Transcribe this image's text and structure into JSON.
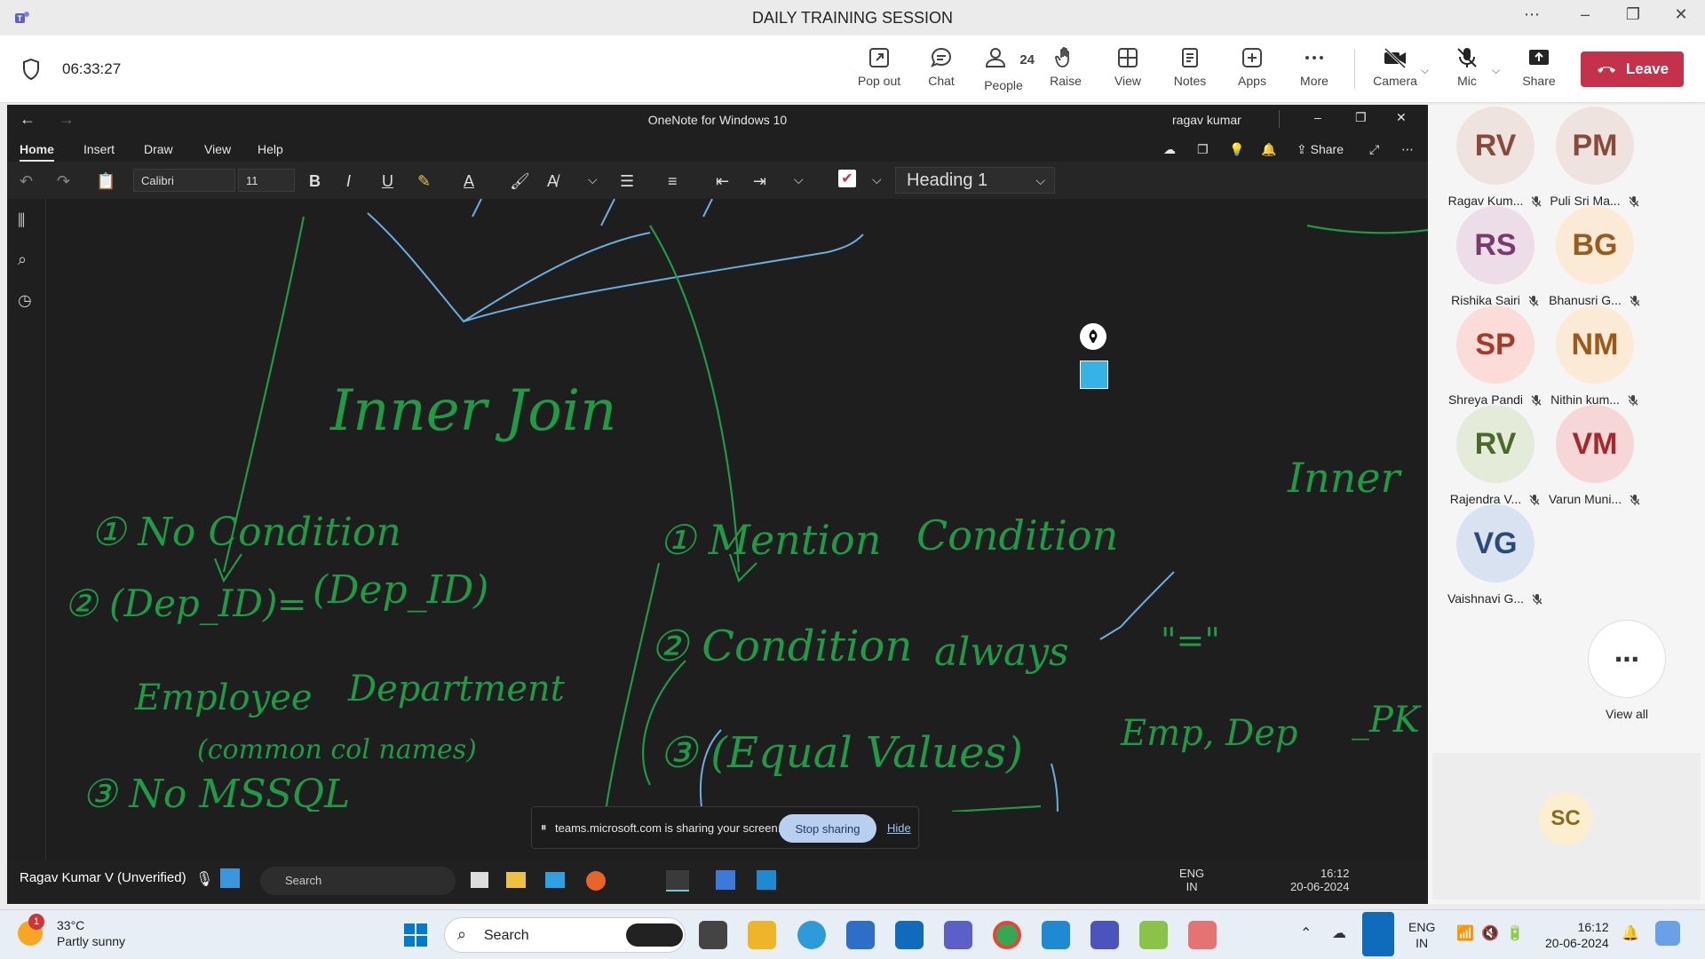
{
  "window": {
    "title": "DAILY TRAINING SESSION"
  },
  "meeting": {
    "timer": "06:33:27",
    "toolbar": [
      {
        "key": "popout",
        "label": "Pop out"
      },
      {
        "key": "chat",
        "label": "Chat"
      },
      {
        "key": "people",
        "label": "People",
        "count": "24"
      },
      {
        "key": "raise",
        "label": "Raise"
      },
      {
        "key": "view",
        "label": "View"
      },
      {
        "key": "notes",
        "label": "Notes"
      },
      {
        "key": "apps",
        "label": "Apps"
      },
      {
        "key": "more",
        "label": "More"
      },
      {
        "key": "camera",
        "label": "Camera"
      },
      {
        "key": "mic",
        "label": "Mic"
      },
      {
        "key": "share",
        "label": "Share"
      }
    ],
    "leave_label": "Leave",
    "leave_color": "#c4314b"
  },
  "onenote": {
    "title": "OneNote for Windows 10",
    "user": "ragav kumar",
    "menu": [
      "Home",
      "Insert",
      "Draw",
      "View",
      "Help"
    ],
    "share_label": "Share",
    "font_name": "Calibri",
    "font_size": "11",
    "style": "Heading 1",
    "ink_color": "#1f9a45",
    "ink_text": {
      "inner_join": "Inner Join",
      "inner": "Inner",
      "l1": "① No Condition",
      "l2a": "② (Dep_ID)",
      "l2b": "(Dep_ID)",
      "employee": "Employee",
      "department": "Department",
      "common": "(common col names)",
      "l3": "③ No MSSQL",
      "r1a": "① Mention",
      "r1b": "Condition",
      "r2a": "② Condition",
      "r2b": "always",
      "r3": "③ (Equal Values)",
      "emp_dep": "Emp, Dep",
      "pk": "_PK",
      "eq": "\"=\""
    }
  },
  "share_banner": {
    "message": "teams.microsoft.com is sharing your screen.",
    "stop_label": "Stop sharing",
    "hide_label": "Hide"
  },
  "inner_taskbar": {
    "presenter": "Ragav Kumar V (Unverified)",
    "search": "Search",
    "lang": "ENG",
    "region": "IN",
    "time": "16:12",
    "date": "20-06-2024"
  },
  "participants": [
    {
      "initials": "RV",
      "name": "Ragav Kum...",
      "bg": "#efe3e0",
      "fg": "#8a4a3a"
    },
    {
      "initials": "PM",
      "name": "Puli Sri Ma...",
      "bg": "#efe3e0",
      "fg": "#8a4a3a"
    },
    {
      "initials": "RS",
      "name": "Rishika Sairi",
      "bg": "#ecdde9",
      "fg": "#7a3a6a"
    },
    {
      "initials": "BG",
      "name": "Bhanusri G...",
      "bg": "#fbead6",
      "fg": "#9a5a1a"
    },
    {
      "initials": "SP",
      "name": "Shreya Pandi",
      "bg": "#fbdcd8",
      "fg": "#a33a2a"
    },
    {
      "initials": "NM",
      "name": "Nithin kum...",
      "bg": "#fbead6",
      "fg": "#9a5a1a"
    },
    {
      "initials": "RV",
      "name": "Rajendra V...",
      "bg": "#e4ecd9",
      "fg": "#4a6a2a"
    },
    {
      "initials": "VM",
      "name": "Varun Muni...",
      "bg": "#f6d6d6",
      "fg": "#a32a2a"
    },
    {
      "initials": "VG",
      "name": "Vaishnavi G...",
      "bg": "#d8e2f0",
      "fg": "#2a4a7a"
    }
  ],
  "view_all_label": "View all",
  "active_tile": {
    "initials": "SC",
    "bg": "#fbefcf",
    "fg": "#8a6a1a"
  },
  "taskbar": {
    "weather_temp": "33°C",
    "weather_desc": "Partly sunny",
    "weather_badge": "1",
    "search": "Search",
    "lang": "ENG",
    "region": "IN",
    "time": "16:12",
    "date": "20-06-2024"
  }
}
